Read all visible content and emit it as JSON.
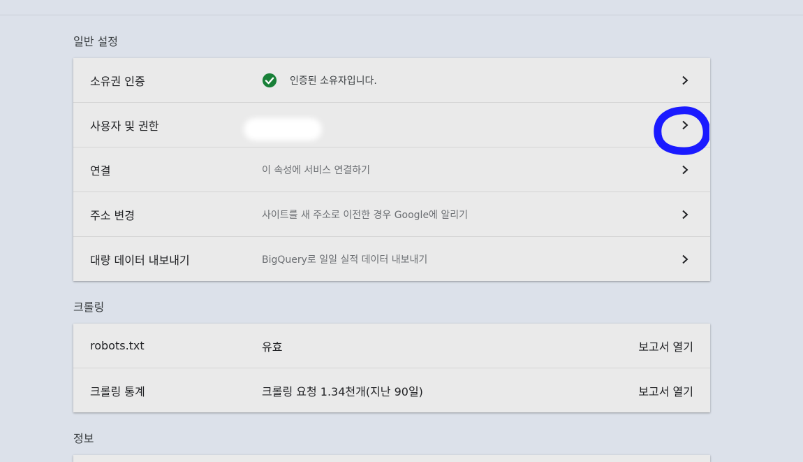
{
  "sections": {
    "general": {
      "title": "일반 설정",
      "rows": [
        {
          "label": "소유권 인증",
          "desc": "인증된 소유자입니다."
        },
        {
          "label": "사용자 및 권한",
          "desc": ""
        },
        {
          "label": "연결",
          "desc": "이 속성에 서비스 연결하기"
        },
        {
          "label": "주소 변경",
          "desc": "사이트를 새 주소로 이전한 경우 Google에 알리기"
        },
        {
          "label": "대량 데이터 내보내기",
          "desc": "BigQuery로 일일 실적 데이터 내보내기"
        }
      ]
    },
    "crawling": {
      "title": "크롤링",
      "rows": [
        {
          "label": "robots.txt",
          "value": "유효",
          "action": "보고서 열기"
        },
        {
          "label": "크롤링 통계",
          "value": "크롤링 요청 1.34천개(지난 90일)",
          "action": "보고서 열기"
        }
      ]
    },
    "info": {
      "title": "정보"
    }
  },
  "colors": {
    "background": "#dce1ea",
    "card": "#eaeaea",
    "verified_green": "#188038",
    "annotation_circle": "#1a1aff"
  },
  "icons": {
    "verified": "check-circle-icon",
    "row_chevron": "chevron-right-icon"
  }
}
